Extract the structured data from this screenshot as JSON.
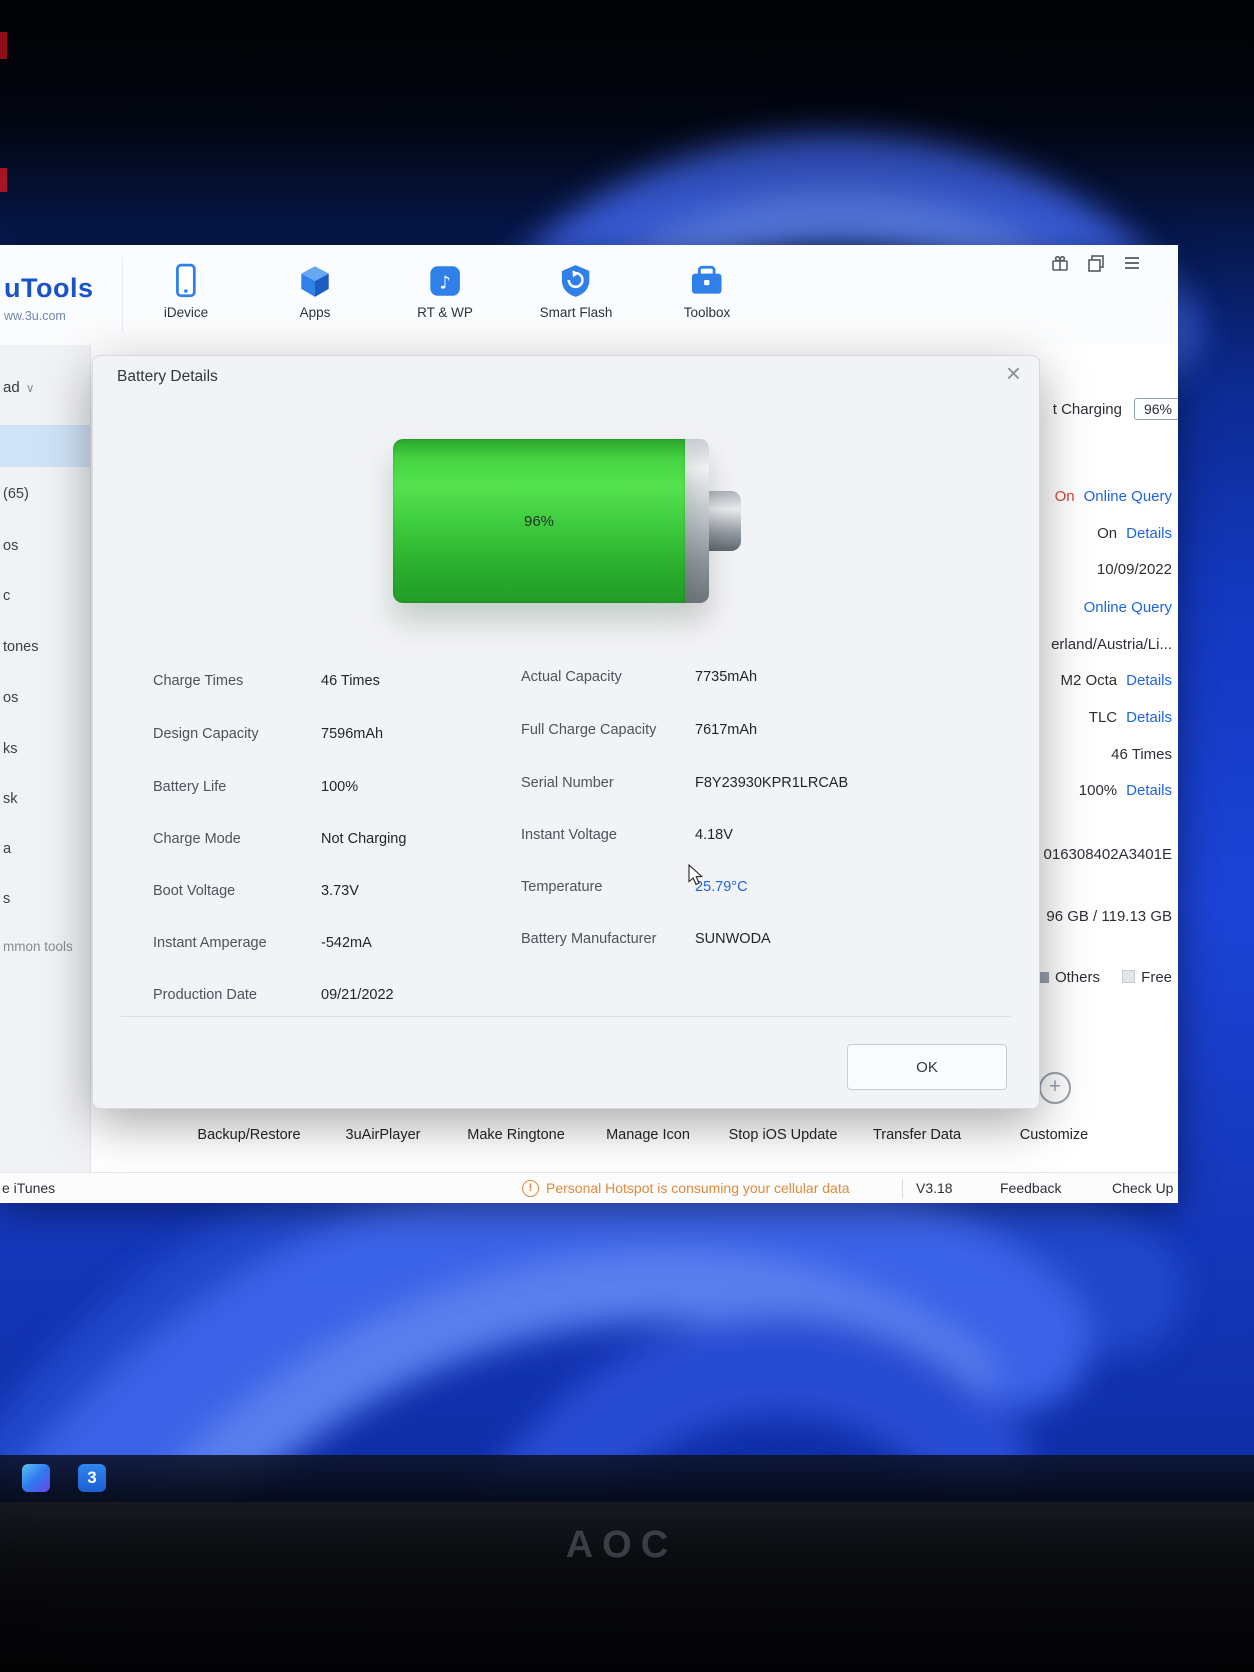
{
  "colors": {
    "accent-blue": "#2f80e8",
    "link-blue": "#1d66e0",
    "alert-red": "#d84334",
    "warn-orange": "#e08a3c",
    "battery-green": "#3ecb3e"
  },
  "app": {
    "logo_title": "uTools",
    "logo_subtitle": "ww.3u.com",
    "nav": [
      {
        "label": "iDevice"
      },
      {
        "label": "Apps"
      },
      {
        "label": "RT & WP"
      },
      {
        "label": "Smart Flash"
      },
      {
        "label": "Toolbox"
      }
    ]
  },
  "sidebar": {
    "header": "ad",
    "header_chevron": "∨",
    "items": [
      "(65)",
      "os",
      "c",
      "tones",
      "os",
      "ks",
      "sk",
      "a",
      "s",
      "mmon tools"
    ]
  },
  "device_panel": {
    "charging_text": "t Charging",
    "charging_badge": "96%",
    "rows": [
      {
        "prefix": "On",
        "link": "Online Query"
      },
      {
        "prefix": "On",
        "link": "Details"
      },
      {
        "text": "10/09/2022"
      },
      {
        "link": "Online Query"
      },
      {
        "text": "erland/Austria/Li..."
      },
      {
        "prefix": "M2 Octa",
        "link": "Details"
      },
      {
        "prefix": "TLC",
        "link": "Details"
      },
      {
        "text": "46 Times"
      },
      {
        "prefix": "100%",
        "link": "Details"
      },
      {
        "text": "016308402A3401E"
      },
      {
        "text": "96 GB / 119.13 GB"
      }
    ],
    "legend": [
      {
        "label": "Others"
      },
      {
        "label": "Free"
      }
    ]
  },
  "dialog": {
    "title": "Battery Details",
    "close_glyph": "×",
    "battery_percent": "96%",
    "rows_left": [
      {
        "label": "Charge Times",
        "value": "46 Times"
      },
      {
        "label": "Design Capacity",
        "value": "7596mAh"
      },
      {
        "label": "Battery Life",
        "value": "100%"
      },
      {
        "label": "Charge Mode",
        "value": "Not Charging"
      },
      {
        "label": "Boot Voltage",
        "value": "3.73V"
      },
      {
        "label": "Instant Amperage",
        "value": "-542mA"
      },
      {
        "label": "Production Date",
        "value": "09/21/2022"
      }
    ],
    "rows_right": [
      {
        "label": "Actual Capacity",
        "value": "7735mAh"
      },
      {
        "label": "Full Charge Capacity",
        "value": "7617mAh"
      },
      {
        "label": "Serial Number",
        "value": "F8Y23930KPR1LRCAB"
      },
      {
        "label": "Instant Voltage",
        "value": "4.18V"
      },
      {
        "label": "Temperature",
        "value": "25.79°C"
      },
      {
        "label": "Battery Manufacturer",
        "value": "SUNWODA"
      }
    ],
    "ok_label": "OK"
  },
  "bottom_toolbar": {
    "items": [
      "Backup/Restore",
      "3uAirPlayer",
      "Make Ringtone",
      "Manage Icon",
      "Stop iOS Update",
      "Transfer Data",
      "Customize"
    ],
    "customize_plus": "+"
  },
  "status_bar": {
    "left": "e iTunes",
    "warning_glyph": "!",
    "warning": "Personal Hotspot is consuming your cellular data",
    "version": "V3.18",
    "feedback": "Feedback",
    "check_update": "Check Up"
  },
  "taskbar": {
    "badge": "3"
  },
  "monitor": {
    "brand": "AOC"
  }
}
